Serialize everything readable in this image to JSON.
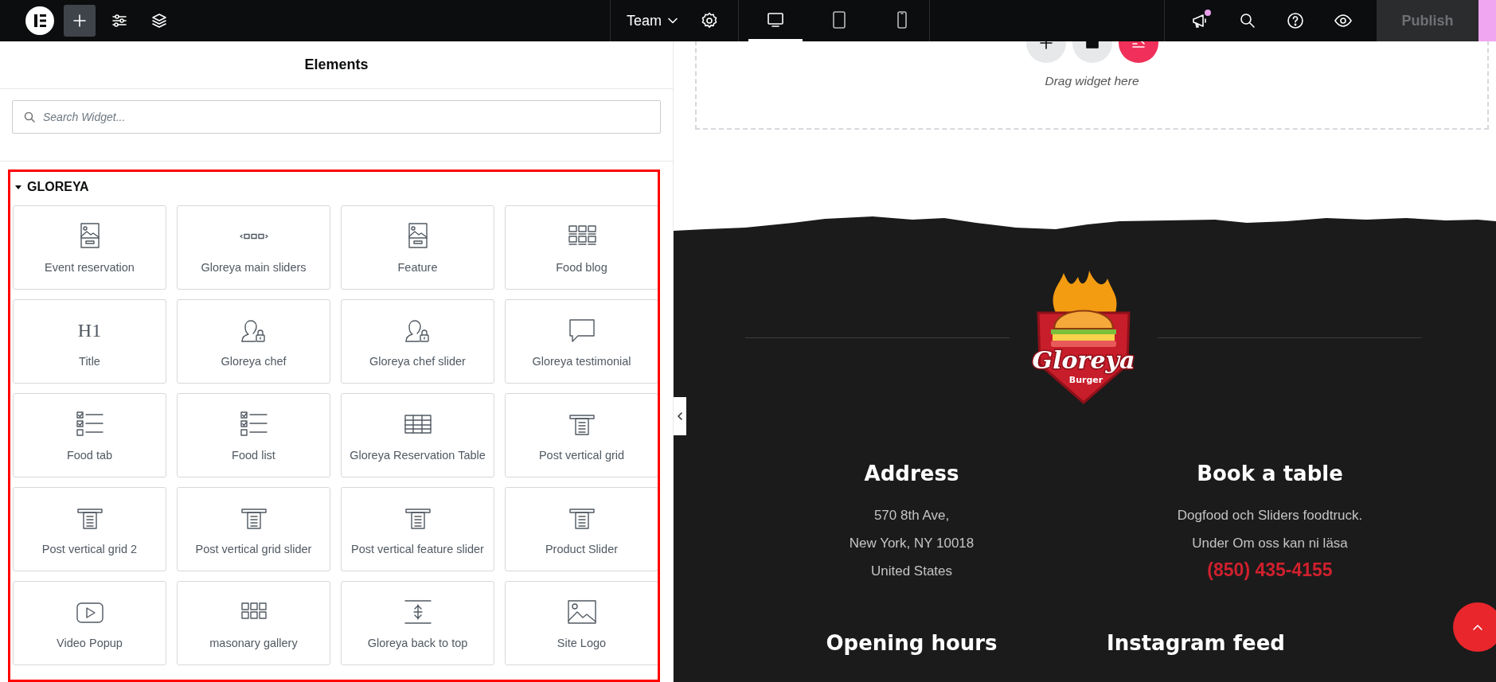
{
  "top_bar": {
    "tools": [
      {
        "kind": "logo",
        "selected": false
      },
      {
        "kind": "add",
        "selected": true
      },
      {
        "kind": "sliders",
        "selected": false
      },
      {
        "kind": "layers",
        "selected": false
      }
    ],
    "site_menu": {
      "label": "Team"
    },
    "devices": [
      {
        "kind": "desktop",
        "selected": true
      },
      {
        "kind": "tablet",
        "selected": false
      },
      {
        "kind": "mobile",
        "selected": false
      }
    ],
    "actions": [
      {
        "kind": "megaphone",
        "notification": true
      },
      {
        "kind": "search",
        "notification": false
      },
      {
        "kind": "help",
        "notification": false
      },
      {
        "kind": "eye",
        "notification": false
      }
    ],
    "publish": {
      "label": "Publish",
      "disabled": true
    }
  },
  "panel": {
    "title": "Elements",
    "search": {
      "placeholder": "Search Widget..."
    },
    "category": {
      "label": "GLOREYA",
      "expanded": true,
      "highlighted": true,
      "widgets": [
        {
          "label": "Event reservation",
          "kind": "image-card"
        },
        {
          "label": "Gloreya main sliders",
          "kind": "slider"
        },
        {
          "label": "Feature",
          "kind": "image-card"
        },
        {
          "label": "Food blog",
          "kind": "grid"
        },
        {
          "label": "Title",
          "kind": "heading",
          "glyph": "H1"
        },
        {
          "label": "Gloreya chef",
          "kind": "user-lock"
        },
        {
          "label": "Gloreya chef slider",
          "kind": "user-lock"
        },
        {
          "label": "Gloreya testimonial",
          "kind": "comment"
        },
        {
          "label": "Food tab",
          "kind": "checklist"
        },
        {
          "label": "Food list",
          "kind": "checklist"
        },
        {
          "label": "Gloreya Reservation Table",
          "kind": "table"
        },
        {
          "label": "Post vertical grid",
          "kind": "post"
        },
        {
          "label": "Post vertical grid 2",
          "kind": "post"
        },
        {
          "label": "Post vertical grid slider",
          "kind": "post"
        },
        {
          "label": "Post vertical feature slider",
          "kind": "post"
        },
        {
          "label": "Product Slider",
          "kind": "post"
        },
        {
          "label": "Video Popup",
          "kind": "video"
        },
        {
          "label": "masonary gallery",
          "kind": "gallery"
        },
        {
          "label": "Gloreya back to top",
          "kind": "back-to-top"
        },
        {
          "label": "Site Logo",
          "kind": "image"
        }
      ]
    }
  },
  "canvas": {
    "drop_zone": {
      "hint": "Drag widget here",
      "buttons": [
        {
          "kind": "add"
        },
        {
          "kind": "folder"
        },
        {
          "kind": "template"
        }
      ]
    },
    "footer": {
      "logo": {
        "title": "Gloreya",
        "subtitle": "Burger"
      },
      "sections": [
        {
          "heading": "Address",
          "lines": [
            "570 8th Ave,",
            "New York, NY 10018",
            "United States"
          ]
        },
        {
          "heading": "Book a table",
          "lines": [
            "Dogfood och Sliders foodtruck.",
            "Under Om oss kan ni läsa"
          ],
          "phone": "(850) 435-4155"
        },
        {
          "heading": "Opening hours"
        },
        {
          "heading": "Instagram feed"
        }
      ]
    }
  }
}
